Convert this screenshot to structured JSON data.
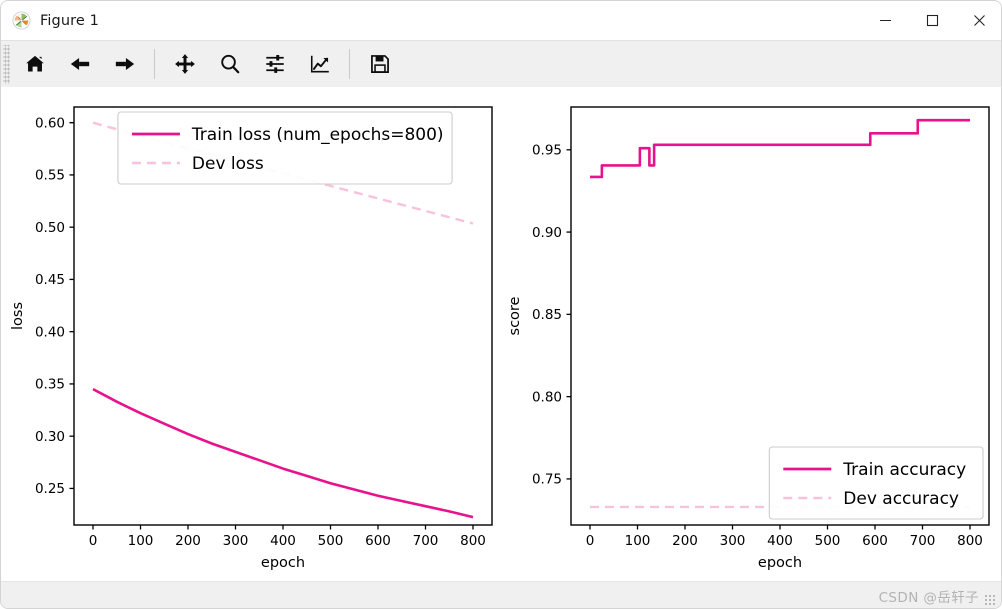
{
  "window": {
    "title": "Figure 1",
    "icon": "matplotlib-logo-icon",
    "controls": {
      "minimize": "minimize-icon",
      "maximize": "maximize-icon",
      "close": "close-icon"
    }
  },
  "toolbar": {
    "buttons": [
      {
        "name": "home-icon",
        "tooltip": "Reset original view"
      },
      {
        "name": "back-arrow-icon",
        "tooltip": "Back to previous view"
      },
      {
        "name": "forward-arrow-icon",
        "tooltip": "Forward to next view"
      },
      {
        "name": "pan-move-icon",
        "tooltip": "Pan axes with left mouse, zoom with right"
      },
      {
        "name": "zoom-magnifier-icon",
        "tooltip": "Zoom to rectangle"
      },
      {
        "name": "configure-subplots-icon",
        "tooltip": "Configure subplots"
      },
      {
        "name": "edit-axis-curve-icon",
        "tooltip": "Edit axis, curve and image parameters"
      },
      {
        "name": "save-floppy-icon",
        "tooltip": "Save the figure"
      }
    ]
  },
  "statusbar": {
    "watermark": "CSDN @岳轩子"
  },
  "colors": {
    "train": "#E8128C",
    "dev": "#F7C2DB",
    "axis": "#000000",
    "text": "#000000",
    "legend_border": "#cccccc",
    "figure_bg": "#ffffff"
  },
  "chart_data": [
    {
      "type": "line",
      "id": "loss-chart",
      "title": "",
      "xlabel": "epoch",
      "ylabel": "loss",
      "xlim": [
        -40,
        840
      ],
      "ylim": [
        0.215,
        0.615
      ],
      "xticks": [
        0,
        100,
        200,
        300,
        400,
        500,
        600,
        700,
        800
      ],
      "yticks": [
        0.25,
        0.3,
        0.35,
        0.4,
        0.45,
        0.5,
        0.55,
        0.6
      ],
      "xticklabels": [
        "0",
        "100",
        "200",
        "300",
        "400",
        "500",
        "600",
        "700",
        "800"
      ],
      "yticklabels": [
        "0.25",
        "0.30",
        "0.35",
        "0.40",
        "0.45",
        "0.50",
        "0.55",
        "0.60"
      ],
      "grid": false,
      "legend_position": "upper center",
      "legend": [
        {
          "label": "Train loss (num_epochs=800)",
          "style": "solid",
          "color": "#E8128C"
        },
        {
          "label": "Dev loss",
          "style": "dashed",
          "color": "#F7C2DB"
        }
      ],
      "series": [
        {
          "name": "Train loss (num_epochs=800)",
          "style": "solid",
          "color": "#E8128C",
          "x": [
            0,
            50,
            100,
            150,
            200,
            250,
            300,
            350,
            400,
            450,
            500,
            550,
            600,
            650,
            700,
            750,
            800
          ],
          "y": [
            0.345,
            0.333,
            0.322,
            0.312,
            0.302,
            0.293,
            0.285,
            0.277,
            0.269,
            0.262,
            0.255,
            0.249,
            0.243,
            0.238,
            0.233,
            0.228,
            0.2225
          ]
        },
        {
          "name": "Dev loss",
          "style": "dashed",
          "color": "#F7C2DB",
          "x": [
            0,
            100,
            200,
            300,
            400,
            500,
            600,
            700,
            800
          ],
          "y": [
            0.6,
            0.5875,
            0.5755,
            0.5635,
            0.5515,
            0.5395,
            0.5275,
            0.5155,
            0.5035
          ]
        }
      ]
    },
    {
      "type": "line",
      "id": "score-chart",
      "title": "",
      "xlabel": "epoch",
      "ylabel": "score",
      "xlim": [
        -40,
        840
      ],
      "ylim": [
        0.722,
        0.976
      ],
      "xticks": [
        0,
        100,
        200,
        300,
        400,
        500,
        600,
        700,
        800
      ],
      "yticks": [
        0.75,
        0.8,
        0.85,
        0.9,
        0.95
      ],
      "xticklabels": [
        "0",
        "100",
        "200",
        "300",
        "400",
        "500",
        "600",
        "700",
        "800"
      ],
      "yticklabels": [
        "0.75",
        "0.80",
        "0.85",
        "0.90",
        "0.95"
      ],
      "grid": false,
      "legend_position": "lower right",
      "legend": [
        {
          "label": "Train accuracy",
          "style": "solid",
          "color": "#E8128C"
        },
        {
          "label": "Dev accuracy",
          "style": "dashed",
          "color": "#F7C2DB"
        }
      ],
      "series": [
        {
          "name": "Train accuracy",
          "style": "step",
          "color": "#E8128C",
          "x": [
            0,
            25,
            25,
            105,
            105,
            125,
            125,
            135,
            135,
            165,
            165,
            800
          ],
          "y": [
            0.9335,
            0.9335,
            0.9405,
            0.9405,
            0.951,
            0.951,
            0.9405,
            0.9405,
            0.946,
            0.946,
            0.946,
            0.946
          ],
          "steps": [
            {
              "from_epoch": 0,
              "to_epoch": 25,
              "value": 0.9335
            },
            {
              "from_epoch": 25,
              "to_epoch": 105,
              "value": 0.9405
            },
            {
              "from_epoch": 105,
              "to_epoch": 125,
              "value": 0.951
            },
            {
              "from_epoch": 125,
              "to_epoch": 135,
              "value": 0.9405
            },
            {
              "from_epoch": 135,
              "to_epoch": 590,
              "value": 0.953
            },
            {
              "from_epoch": 590,
              "to_epoch": 690,
              "value": 0.96
            },
            {
              "from_epoch": 690,
              "to_epoch": 800,
              "value": 0.968
            }
          ]
        },
        {
          "name": "Dev accuracy",
          "style": "dashed",
          "color": "#F7C2DB",
          "x": [
            0,
            800
          ],
          "y": [
            0.733,
            0.733
          ]
        }
      ]
    }
  ]
}
